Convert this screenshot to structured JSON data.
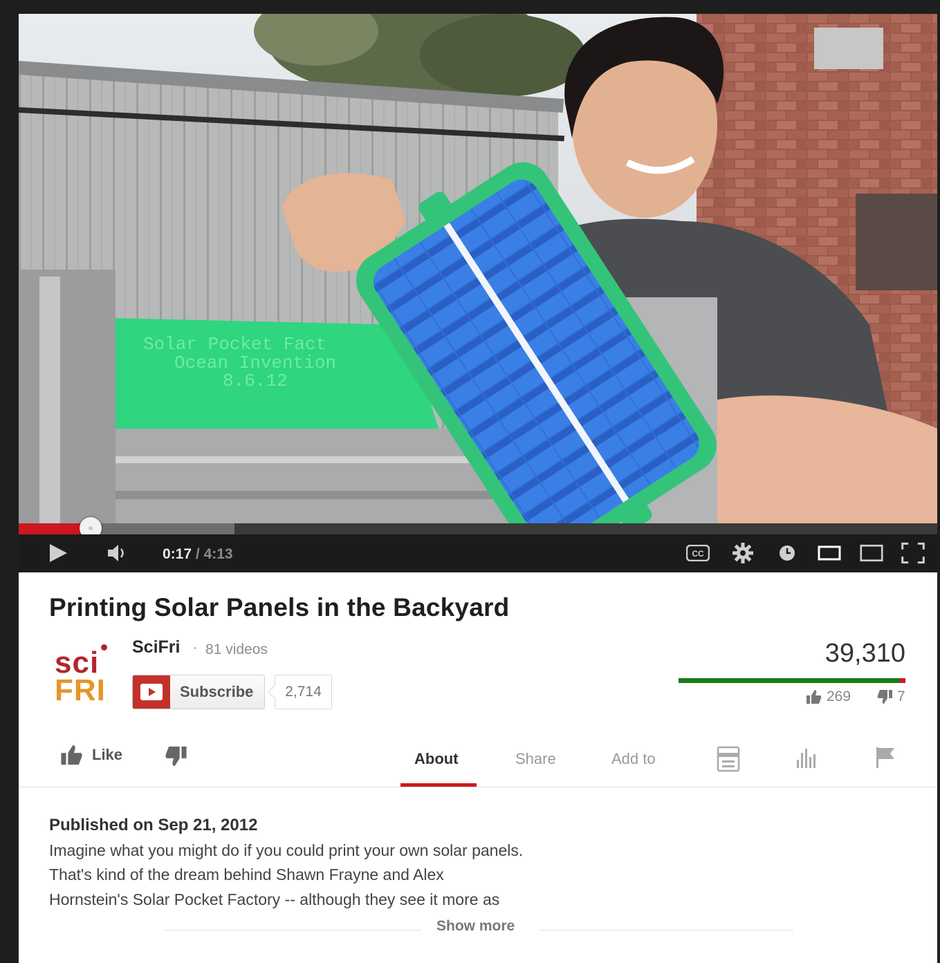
{
  "player": {
    "current_time": "0:17",
    "separator": "/",
    "duration": "4:13",
    "played_fraction": 0.078,
    "buffered_fraction": 0.235,
    "video_overlay_text": [
      "Solar Pocket Fact",
      "Ocean Invention",
      "8.6.12"
    ]
  },
  "video": {
    "title": "Printing Solar Panels in the Backyard",
    "view_count": "39,310",
    "like_count": "269",
    "dislike_count": "7",
    "published": "Published on Sep 21, 2012",
    "description_lines": [
      "Imagine what you might do if you could print your own solar panels.",
      "That's kind of the dream behind Shawn Frayne and Alex",
      "Hornstein's Solar Pocket Factory -- although they see it more as"
    ],
    "show_more": "Show more"
  },
  "channel": {
    "logo_line1": "sci",
    "logo_line2": "FRI",
    "name": "SciFri",
    "separator": "·",
    "video_count": "81 videos",
    "subscribe_label": "Subscribe",
    "subscriber_count": "2,714"
  },
  "actions": {
    "like_label": "Like",
    "tabs": [
      {
        "label": "About",
        "active": true
      },
      {
        "label": "Share",
        "active": false
      },
      {
        "label": "Add to",
        "active": false
      }
    ]
  },
  "colors": {
    "accent_red": "#cc181e",
    "like_green": "#1a7a1a",
    "logo_red": "#b1262b",
    "logo_orange": "#e6952b"
  },
  "icons": [
    "play-icon",
    "volume-icon",
    "cc-icon",
    "settings-gear-icon",
    "watch-later-icon",
    "small-player-icon",
    "large-player-icon",
    "fullscreen-icon",
    "thumbs-up-icon",
    "thumbs-down-icon",
    "transcript-icon",
    "stats-icon",
    "flag-icon"
  ]
}
